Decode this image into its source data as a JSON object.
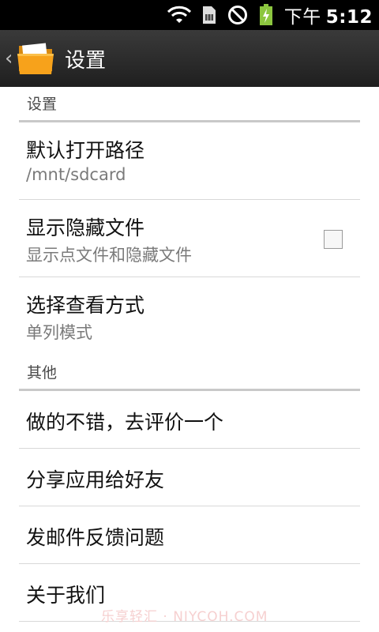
{
  "status_bar": {
    "time_prefix": "下午",
    "time": "5:12",
    "icons": [
      "wifi-icon",
      "sim-card-icon",
      "no-signal-icon",
      "battery-charging-icon"
    ]
  },
  "action_bar": {
    "back_glyph": "‹",
    "title": "设置",
    "icon": "folder-icon"
  },
  "sections": {
    "settings_header": "设置",
    "other_header": "其他"
  },
  "prefs": {
    "default_path": {
      "title": "默认打开路径",
      "summary": "/mnt/sdcard"
    },
    "show_hidden": {
      "title": "显示隐藏文件",
      "summary": "显示点文件和隐藏文件",
      "checked": false
    },
    "view_mode": {
      "title": "选择查看方式",
      "summary": "单列模式"
    }
  },
  "other_items": {
    "rate": "做的不错，去评价一个",
    "share": "分享应用给好友",
    "feedback": "发邮件反馈问题",
    "about": "关于我们"
  },
  "watermark": "乐享轻汇 · NIYCOH.COM",
  "colors": {
    "action_bar": "#2b2b2b",
    "folder": "#f7a21b",
    "section_divider": "#c9c9c9",
    "battery": "#8cc63f"
  }
}
